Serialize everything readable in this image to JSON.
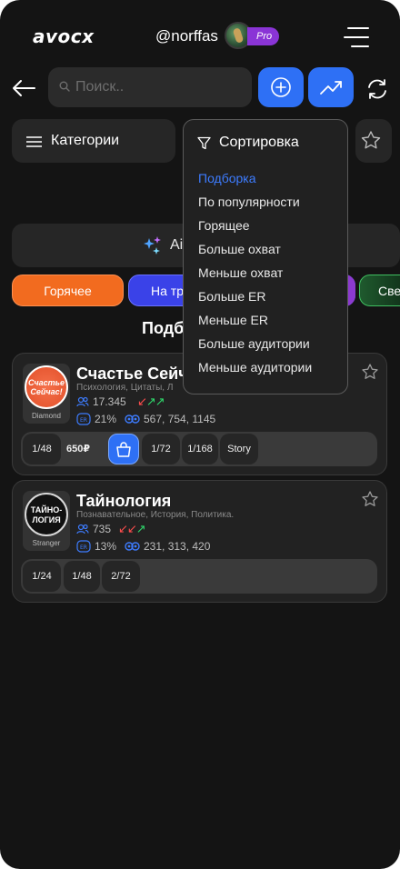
{
  "header": {
    "logo": "avocx",
    "username": "@norffas",
    "badge": "Pro"
  },
  "search": {
    "placeholder": "Поиск.."
  },
  "filters": {
    "categories_label": "Категории",
    "sort_label": "Сортировка"
  },
  "ai_bar": {
    "label": "Ai"
  },
  "chips": {
    "hot": "Горячее",
    "trend": "На тра",
    "green": "Све"
  },
  "section_title": "Подб",
  "sort_menu": {
    "options": [
      "Подборка",
      "По популярности",
      "Горящее",
      "Больше охват",
      "Меньше охват",
      "Больше ER",
      "Меньше ER",
      "Больше аудитории",
      "Меньше аудитории"
    ],
    "selected_index": 0
  },
  "channels": [
    {
      "title": "Счастье Сейч",
      "subtitle": "Психология, Цитаты, Л",
      "logo_text": "Счастье Сейчас!",
      "tier": "Diamond",
      "subscribers": "17.345",
      "er": "21%",
      "reach": "567, 754, 1145",
      "slots": [
        "1/48",
        "650₽",
        "1/72",
        "1/168",
        "Story"
      ]
    },
    {
      "title": "Тайнология",
      "subtitle": "Познавательное, История, Политика.",
      "logo_text": "ТАЙНО-ЛОГИЯ",
      "tier": "Stranger",
      "subscribers": "735",
      "er": "13%",
      "reach": "231, 313, 420",
      "slots": [
        "1/24",
        "1/48",
        "2/72"
      ]
    }
  ],
  "colors": {
    "accent_blue": "#2e70f5",
    "hot_orange": "#f26b1f",
    "pro_purple": "#8a34d6",
    "arrow_down": "#ff4d4d",
    "arrow_up": "#2fd66b"
  }
}
